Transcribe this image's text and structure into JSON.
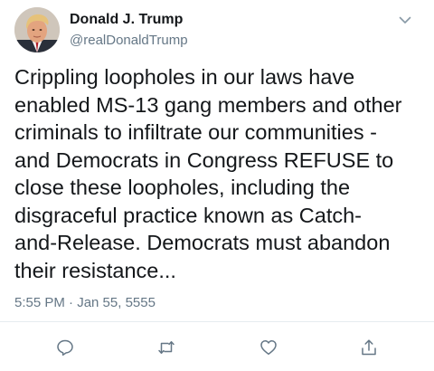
{
  "tweet": {
    "author_name": "Donald J. Trump",
    "author_handle": "@realDonaldTrump",
    "text": "Crippling loopholes in our laws have\nenabled MS-13 gang members and other\ncriminals to infiltrate our communities -\nand Democrats in Congress REFUSE to\nclose these loopholes, including the\ndisgraceful practice known as Catch-\nand-Release. Democrats must abandon\ntheir resistance...",
    "timestamp": "5:55 PM · Jan 55, 5555"
  },
  "icons": {
    "menu": "chevron-down-icon",
    "reply": "reply-icon",
    "retweet": "retweet-icon",
    "like": "heart-icon",
    "share": "share-icon"
  },
  "colors": {
    "text": "#14171a",
    "secondary": "#657786",
    "icon": "#657786",
    "divider": "#e6ecf0"
  }
}
